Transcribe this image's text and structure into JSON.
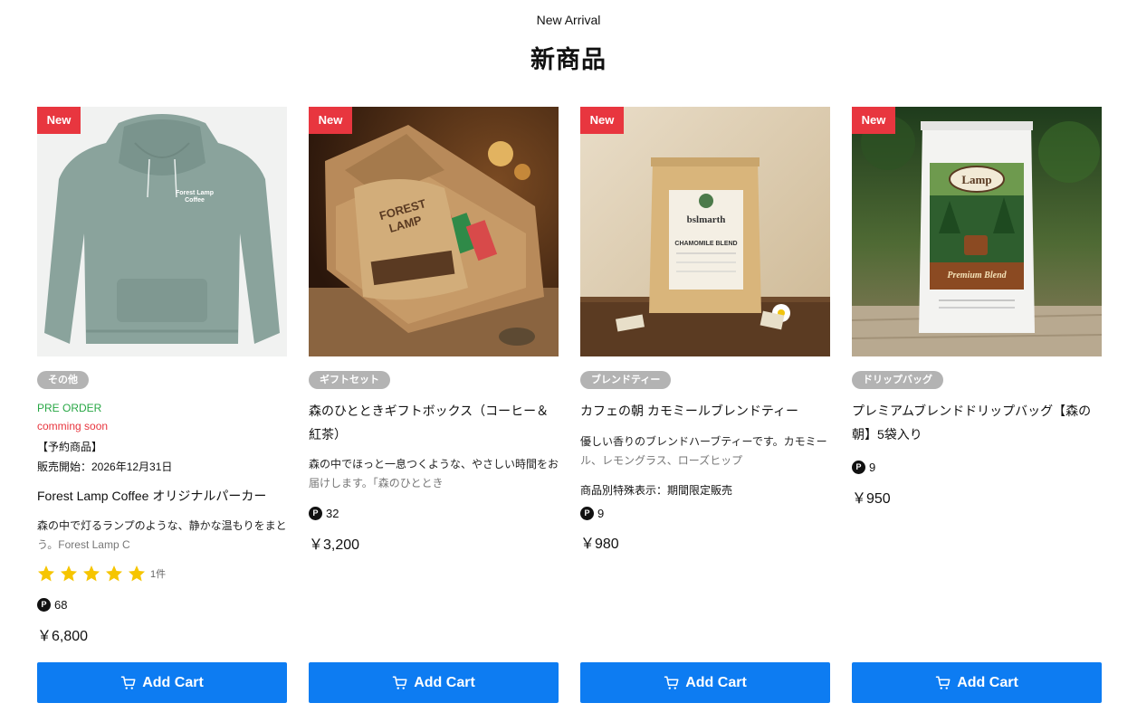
{
  "section": {
    "subtitle": "New Arrival",
    "title": "新商品"
  },
  "products": [
    {
      "badge": "New",
      "category": "その他",
      "preorder": "PRE ORDER",
      "coming": "comming soon",
      "reserve": "【予約商品】",
      "sale_start": "販売開始：2026年12月31日",
      "name": "Forest Lamp Coffee オリジナルパーカー",
      "desc_line1": "森の中で灯るランプのような、静かな温もりをまと",
      "desc_line2": "う。Forest Lamp C",
      "rating": 5,
      "review_count": "1件",
      "points_icon": "P",
      "points": "68",
      "price": "￥6,800",
      "cart_label": "Add Cart",
      "image_text": "Forest Lamp Coffee"
    },
    {
      "badge": "New",
      "category": "ギフトセット",
      "name_line1": "森のひとときギフトボックス（コーヒー＆",
      "name_line2": "紅茶）",
      "desc_line1": "森の中でほっと一息つくような、やさしい時間をお",
      "desc_line2": "届けします。「森のひととき",
      "points_icon": "P",
      "points": "32",
      "price": "￥3,200",
      "cart_label": "Add Cart",
      "image_text": "FOREST LAMP"
    },
    {
      "badge": "New",
      "category": "ブレンドティー",
      "name": "カフェの朝 カモミールブレンドティー",
      "desc_line1": "優しい香りのブレンドハーブティーです。カモミー",
      "desc_line2": "ル、レモングラス、ローズヒップ",
      "note": "商品別特殊表示：期間限定販売",
      "points_icon": "P",
      "points": "9",
      "price": "￥980",
      "cart_label": "Add Cart",
      "image_brand": "bslmarth",
      "image_label": "CHAMOMILE BLEND"
    },
    {
      "badge": "New",
      "category": "ドリップバッグ",
      "name_line1": "プレミアムブレンドドリップバッグ【森の",
      "name_line2": "朝】5袋入り",
      "points_icon": "P",
      "points": "9",
      "price": "￥950",
      "cart_label": "Add Cart",
      "image_brand": "Lamp",
      "image_label": "Premium Blend"
    }
  ],
  "colors": {
    "badge_red": "#e8363f",
    "cart_blue": "#0d7cf2",
    "preorder_green": "#28a745",
    "chip_gray": "#b3b3b3",
    "star_gold": "#f6c500"
  },
  "icons": {
    "cart": "cart-icon",
    "star": "star-icon",
    "points": "point-icon"
  }
}
